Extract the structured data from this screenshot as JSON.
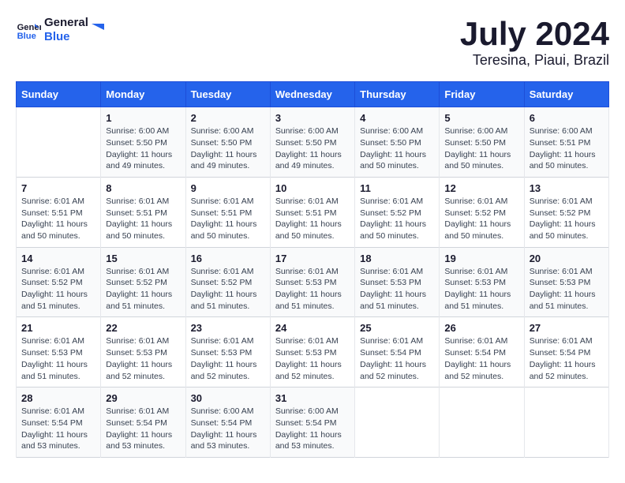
{
  "header": {
    "logo_general": "General",
    "logo_blue": "Blue",
    "main_title": "July 2024",
    "subtitle": "Teresina, Piaui, Brazil"
  },
  "calendar": {
    "weekdays": [
      "Sunday",
      "Monday",
      "Tuesday",
      "Wednesday",
      "Thursday",
      "Friday",
      "Saturday"
    ],
    "weeks": [
      [
        {
          "day": "",
          "sunrise": "",
          "sunset": "",
          "daylight": ""
        },
        {
          "day": "1",
          "sunrise": "Sunrise: 6:00 AM",
          "sunset": "Sunset: 5:50 PM",
          "daylight": "Daylight: 11 hours and 49 minutes."
        },
        {
          "day": "2",
          "sunrise": "Sunrise: 6:00 AM",
          "sunset": "Sunset: 5:50 PM",
          "daylight": "Daylight: 11 hours and 49 minutes."
        },
        {
          "day": "3",
          "sunrise": "Sunrise: 6:00 AM",
          "sunset": "Sunset: 5:50 PM",
          "daylight": "Daylight: 11 hours and 49 minutes."
        },
        {
          "day": "4",
          "sunrise": "Sunrise: 6:00 AM",
          "sunset": "Sunset: 5:50 PM",
          "daylight": "Daylight: 11 hours and 50 minutes."
        },
        {
          "day": "5",
          "sunrise": "Sunrise: 6:00 AM",
          "sunset": "Sunset: 5:50 PM",
          "daylight": "Daylight: 11 hours and 50 minutes."
        },
        {
          "day": "6",
          "sunrise": "Sunrise: 6:00 AM",
          "sunset": "Sunset: 5:51 PM",
          "daylight": "Daylight: 11 hours and 50 minutes."
        }
      ],
      [
        {
          "day": "7",
          "sunrise": "Sunrise: 6:01 AM",
          "sunset": "Sunset: 5:51 PM",
          "daylight": "Daylight: 11 hours and 50 minutes."
        },
        {
          "day": "8",
          "sunrise": "Sunrise: 6:01 AM",
          "sunset": "Sunset: 5:51 PM",
          "daylight": "Daylight: 11 hours and 50 minutes."
        },
        {
          "day": "9",
          "sunrise": "Sunrise: 6:01 AM",
          "sunset": "Sunset: 5:51 PM",
          "daylight": "Daylight: 11 hours and 50 minutes."
        },
        {
          "day": "10",
          "sunrise": "Sunrise: 6:01 AM",
          "sunset": "Sunset: 5:51 PM",
          "daylight": "Daylight: 11 hours and 50 minutes."
        },
        {
          "day": "11",
          "sunrise": "Sunrise: 6:01 AM",
          "sunset": "Sunset: 5:52 PM",
          "daylight": "Daylight: 11 hours and 50 minutes."
        },
        {
          "day": "12",
          "sunrise": "Sunrise: 6:01 AM",
          "sunset": "Sunset: 5:52 PM",
          "daylight": "Daylight: 11 hours and 50 minutes."
        },
        {
          "day": "13",
          "sunrise": "Sunrise: 6:01 AM",
          "sunset": "Sunset: 5:52 PM",
          "daylight": "Daylight: 11 hours and 50 minutes."
        }
      ],
      [
        {
          "day": "14",
          "sunrise": "Sunrise: 6:01 AM",
          "sunset": "Sunset: 5:52 PM",
          "daylight": "Daylight: 11 hours and 51 minutes."
        },
        {
          "day": "15",
          "sunrise": "Sunrise: 6:01 AM",
          "sunset": "Sunset: 5:52 PM",
          "daylight": "Daylight: 11 hours and 51 minutes."
        },
        {
          "day": "16",
          "sunrise": "Sunrise: 6:01 AM",
          "sunset": "Sunset: 5:52 PM",
          "daylight": "Daylight: 11 hours and 51 minutes."
        },
        {
          "day": "17",
          "sunrise": "Sunrise: 6:01 AM",
          "sunset": "Sunset: 5:53 PM",
          "daylight": "Daylight: 11 hours and 51 minutes."
        },
        {
          "day": "18",
          "sunrise": "Sunrise: 6:01 AM",
          "sunset": "Sunset: 5:53 PM",
          "daylight": "Daylight: 11 hours and 51 minutes."
        },
        {
          "day": "19",
          "sunrise": "Sunrise: 6:01 AM",
          "sunset": "Sunset: 5:53 PM",
          "daylight": "Daylight: 11 hours and 51 minutes."
        },
        {
          "day": "20",
          "sunrise": "Sunrise: 6:01 AM",
          "sunset": "Sunset: 5:53 PM",
          "daylight": "Daylight: 11 hours and 51 minutes."
        }
      ],
      [
        {
          "day": "21",
          "sunrise": "Sunrise: 6:01 AM",
          "sunset": "Sunset: 5:53 PM",
          "daylight": "Daylight: 11 hours and 51 minutes."
        },
        {
          "day": "22",
          "sunrise": "Sunrise: 6:01 AM",
          "sunset": "Sunset: 5:53 PM",
          "daylight": "Daylight: 11 hours and 52 minutes."
        },
        {
          "day": "23",
          "sunrise": "Sunrise: 6:01 AM",
          "sunset": "Sunset: 5:53 PM",
          "daylight": "Daylight: 11 hours and 52 minutes."
        },
        {
          "day": "24",
          "sunrise": "Sunrise: 6:01 AM",
          "sunset": "Sunset: 5:53 PM",
          "daylight": "Daylight: 11 hours and 52 minutes."
        },
        {
          "day": "25",
          "sunrise": "Sunrise: 6:01 AM",
          "sunset": "Sunset: 5:54 PM",
          "daylight": "Daylight: 11 hours and 52 minutes."
        },
        {
          "day": "26",
          "sunrise": "Sunrise: 6:01 AM",
          "sunset": "Sunset: 5:54 PM",
          "daylight": "Daylight: 11 hours and 52 minutes."
        },
        {
          "day": "27",
          "sunrise": "Sunrise: 6:01 AM",
          "sunset": "Sunset: 5:54 PM",
          "daylight": "Daylight: 11 hours and 52 minutes."
        }
      ],
      [
        {
          "day": "28",
          "sunrise": "Sunrise: 6:01 AM",
          "sunset": "Sunset: 5:54 PM",
          "daylight": "Daylight: 11 hours and 53 minutes."
        },
        {
          "day": "29",
          "sunrise": "Sunrise: 6:01 AM",
          "sunset": "Sunset: 5:54 PM",
          "daylight": "Daylight: 11 hours and 53 minutes."
        },
        {
          "day": "30",
          "sunrise": "Sunrise: 6:00 AM",
          "sunset": "Sunset: 5:54 PM",
          "daylight": "Daylight: 11 hours and 53 minutes."
        },
        {
          "day": "31",
          "sunrise": "Sunrise: 6:00 AM",
          "sunset": "Sunset: 5:54 PM",
          "daylight": "Daylight: 11 hours and 53 minutes."
        },
        {
          "day": "",
          "sunrise": "",
          "sunset": "",
          "daylight": ""
        },
        {
          "day": "",
          "sunrise": "",
          "sunset": "",
          "daylight": ""
        },
        {
          "day": "",
          "sunrise": "",
          "sunset": "",
          "daylight": ""
        }
      ]
    ]
  }
}
